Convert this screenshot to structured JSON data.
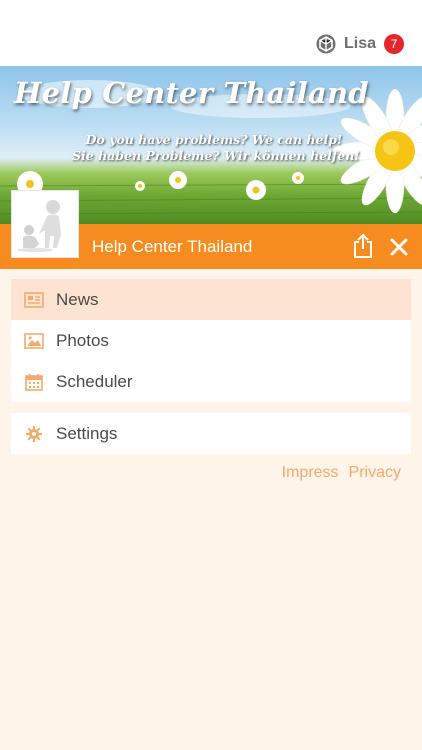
{
  "header": {
    "user_icon": "cube-logo-icon",
    "user_name": "Lisa",
    "notification_count": "7",
    "badge_color": "#e4262a"
  },
  "banner": {
    "title": "Help Center Thailand",
    "subtitle_line1": "Do you have problems? We can help!",
    "subtitle_line2": "Sie haben Probleme? Wir können helfen!"
  },
  "profile": {
    "avatar_icon": "helping-figures-avatar"
  },
  "title_bar": {
    "title": "Help Center Thailand",
    "share_icon": "share-icon",
    "close_icon": "close-icon",
    "color": "#f68b1f"
  },
  "menu": {
    "primary": [
      {
        "label": "News",
        "icon": "newspaper-icon",
        "active": true
      },
      {
        "label": "Photos",
        "icon": "image-icon",
        "active": false
      },
      {
        "label": "Scheduler",
        "icon": "calendar-icon",
        "active": false
      }
    ],
    "secondary": [
      {
        "label": "Settings",
        "icon": "gear-icon",
        "active": false
      }
    ]
  },
  "footer": {
    "impress": "Impress",
    "privacy": "Privacy"
  },
  "colors": {
    "accent": "#f68b1f",
    "background": "#fff4ea",
    "active_row": "#fde3d1",
    "link": "#f5a96a"
  }
}
